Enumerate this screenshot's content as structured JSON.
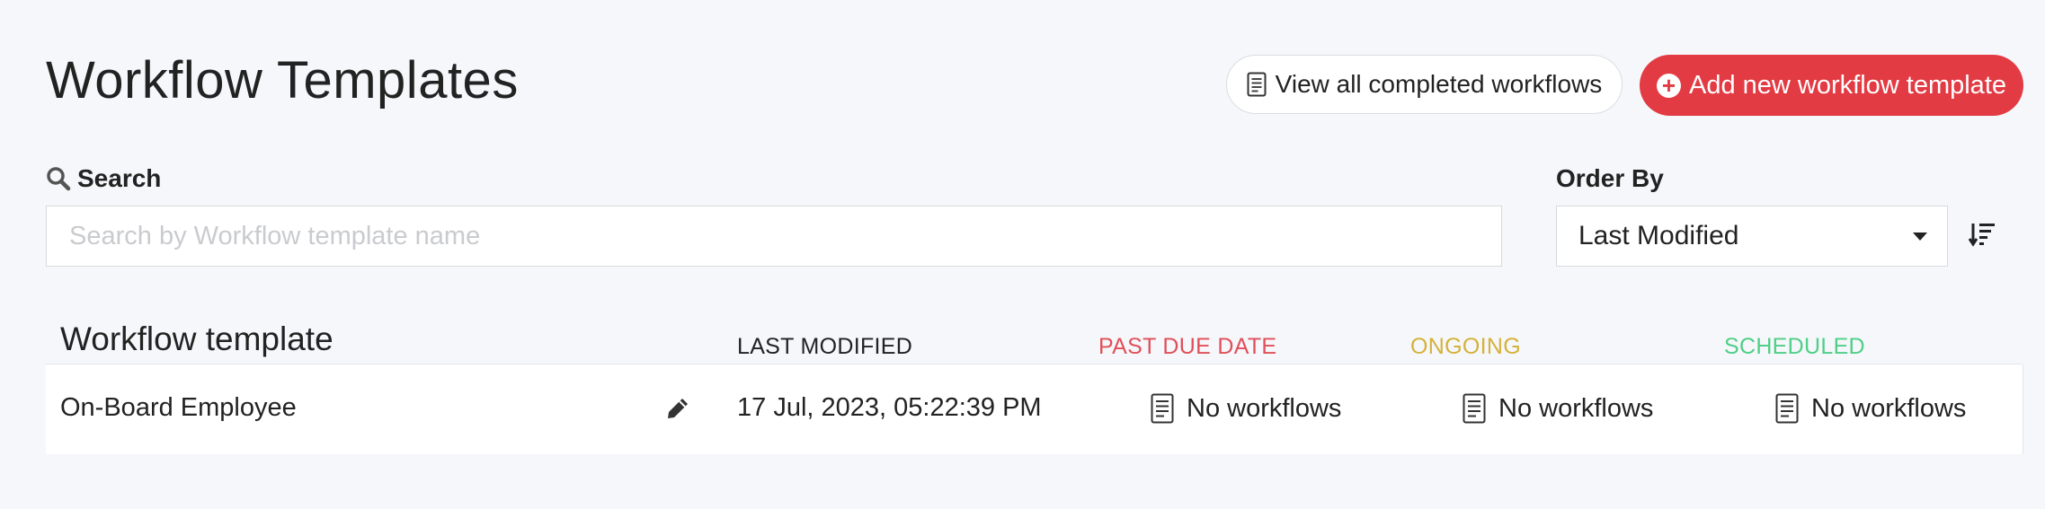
{
  "page": {
    "title": "Workflow Templates"
  },
  "toolbar": {
    "view_completed_label": "View all completed workflows",
    "view_completed_icon": "document-icon",
    "add_template_label": "Add new workflow template",
    "add_template_icon": "plus-circle-icon",
    "accent_color": "#e23b43"
  },
  "search": {
    "label": "Search",
    "icon": "search-icon",
    "placeholder": "Search by Workflow template name",
    "value": ""
  },
  "order": {
    "label": "Order By",
    "selected": "Last Modified",
    "sort_icon": "sort-descending-icon"
  },
  "table": {
    "headers": {
      "name": "Workflow template",
      "last_modified": "LAST MODIFIED",
      "past_due": "PAST DUE DATE",
      "ongoing": "ONGOING",
      "scheduled": "SCHEDULED"
    },
    "header_colors": {
      "past_due": "#e0505a",
      "ongoing": "#d4b23a",
      "scheduled": "#4fcf87"
    },
    "rows": [
      {
        "name": "On-Board Employee",
        "edit_icon": "pencil-icon",
        "last_modified": "17 Jul, 2023, 05:22:39 PM",
        "past_due": "No workflows",
        "ongoing": "No workflows",
        "scheduled": "No workflows"
      }
    ]
  }
}
